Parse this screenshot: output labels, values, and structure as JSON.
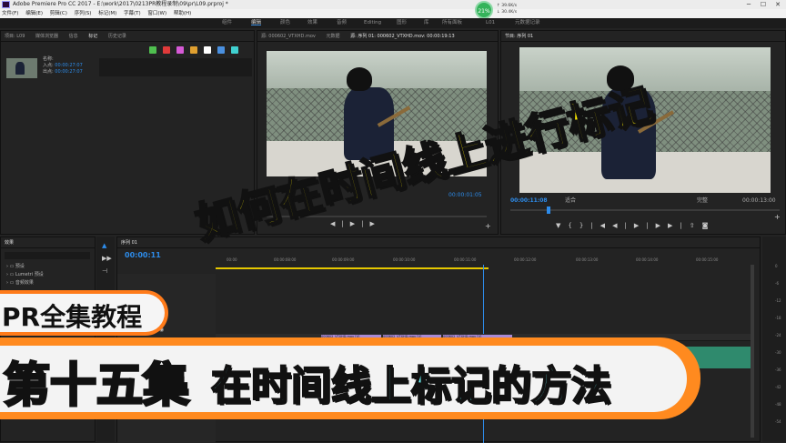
{
  "window": {
    "title": "Adobe Premiere Pro CC 2017 - E:\\work\\2017\\0213PR教程录制\\09\\pr\\L09.prproj *",
    "minimize": "─",
    "maximize": "☐",
    "close": "✕"
  },
  "menu": [
    "文件(F)",
    "编辑(E)",
    "剪辑(C)",
    "序列(S)",
    "标记(M)",
    "字幕(T)",
    "窗口(W)",
    "帮助(H)"
  ],
  "net_meter": {
    "percent": "21%",
    "up": "↑ 39.6K/s",
    "down": "↓ 30.4K/s"
  },
  "workspaces": [
    "组件",
    "编辑",
    "颜色",
    "效果",
    "音频",
    "Editing",
    "图形",
    "库",
    "所有面板",
    "L01",
    "元数据记录"
  ],
  "project_panel": {
    "tabs": [
      "项目: L09",
      "媒体浏览器",
      "信息",
      "标记",
      "历史记录"
    ],
    "selected_tab": "标记",
    "clip_name_label": "名称:",
    "in_label": "入点:",
    "in_value": "00:00:27:07",
    "out_label": "出点:",
    "out_value": "00:00:27:07",
    "marker_colors": [
      "#4fbf4f",
      "#e03a3a",
      "#d65ad6",
      "#e0a030",
      "#ffffff",
      "#4a90e0",
      "#40d0d0"
    ]
  },
  "source_monitor": {
    "tabs": [
      "源: 000602_VTXHD.mov",
      "元数据",
      "源: 序列 01: 000602_VTXHD.mov: 00:00:19:13"
    ],
    "selected_tab": "源: 序列 01: 000602_VTXHD.mov: 00:00:19:13",
    "timecode": "00:00:01:05"
  },
  "program_monitor": {
    "tab": "节目: 序列 01",
    "timecode": "00:00:11:08",
    "fit": "适合",
    "quality": "完整",
    "duration": "00:00:13:00"
  },
  "effects_panel": {
    "tab": "效果",
    "items": [
      "预设",
      "Lumetri 预设",
      "音频效果"
    ]
  },
  "timeline": {
    "tab": "序列 01",
    "timecode": "00:00:11",
    "ruler": [
      "00:00",
      "00:00:08:00",
      "00:00:09:00",
      "00:00:10:00",
      "00:00:11:00",
      "00:00:12:00",
      "00:00:13:00",
      "00:00:14:00",
      "00:00:15:00"
    ],
    "clips": [
      "000602_VTXHD.mov [V]",
      "000602_VTXHD.mov [V]",
      "000602_VTXHD.mov [V]"
    ],
    "meter_ticks": [
      "0",
      "-6",
      "-12",
      "-18",
      "-24",
      "-30",
      "-36",
      "-42",
      "-48",
      "-54"
    ]
  },
  "overlays": {
    "headline": "如何在时间线上进行标记",
    "series": "PR全集教程",
    "episode_number": "第十五集",
    "episode_title": "在时间线上标记的方法"
  },
  "colors": {
    "headline": "#ffee00",
    "banner_orange": "#ff8a1f",
    "episode_title": "#6ef2f4",
    "timecode_blue": "#2d8ceb"
  }
}
